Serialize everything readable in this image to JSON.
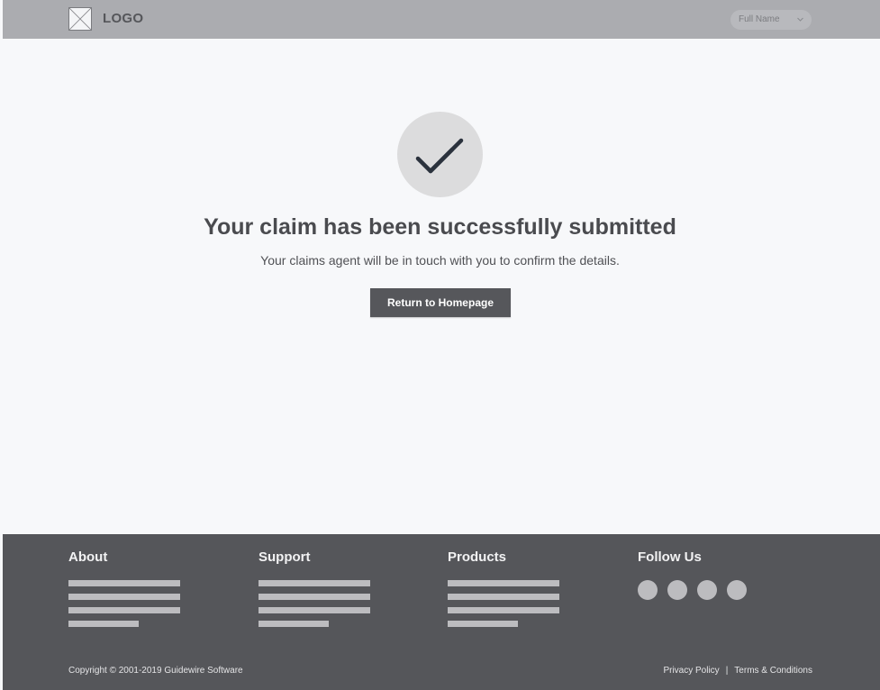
{
  "header": {
    "logo_icon": "image-placeholder-icon",
    "logo_text": "LOGO",
    "user_menu": {
      "label": "Full Name",
      "icon": "chevron-down-icon"
    }
  },
  "main": {
    "status_icon": "checkmark-icon",
    "title": "Your claim has been successfully submitted",
    "subtitle": "Your claims agent will be in touch with you to confirm the details.",
    "return_button_label": "Return to Homepage"
  },
  "footer": {
    "columns": [
      {
        "heading": "About",
        "link_count": 4
      },
      {
        "heading": "Support",
        "link_count": 4
      },
      {
        "heading": "Products",
        "link_count": 4
      }
    ],
    "follow": {
      "heading": "Follow Us",
      "social_icons": [
        "social-icon",
        "social-icon",
        "social-icon",
        "social-icon"
      ]
    },
    "copyright": "Copyright © 2001-2019 Guidewire Software",
    "links": {
      "privacy": "Privacy Policy",
      "separator": "|",
      "terms": "Terms & Conditions"
    }
  },
  "colors": {
    "header_bg": "#abacb0",
    "page_bg": "#f7f8fa",
    "footer_bg": "#55565a",
    "button_bg": "#56575b",
    "check_color": "#2b323d",
    "circle_bg": "#dcdcdd"
  }
}
